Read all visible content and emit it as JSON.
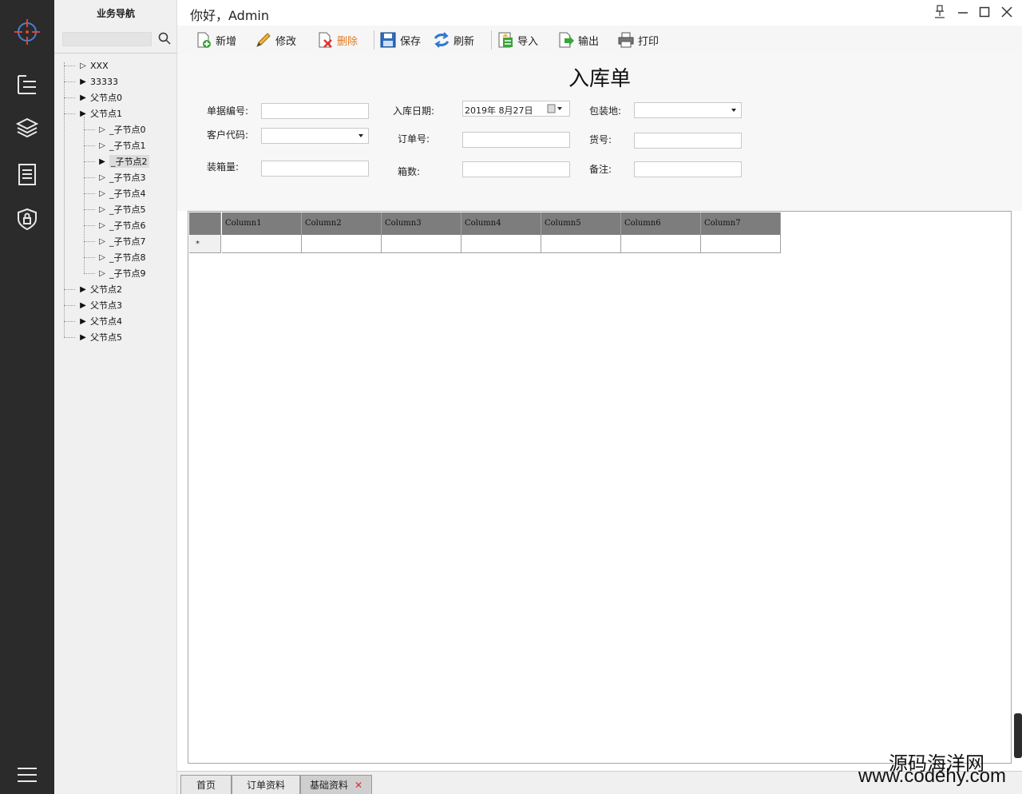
{
  "nav": {
    "title": "业务导航",
    "search_placeholder": "",
    "tree": [
      {
        "label": "XXX",
        "level": 0,
        "expander": "▷"
      },
      {
        "label": "33333",
        "level": 0,
        "expander": "▶"
      },
      {
        "label": "父节点0",
        "level": 0,
        "expander": "▶"
      },
      {
        "label": "父节点1",
        "level": 0,
        "expander": "▶"
      },
      {
        "label": "_子节点0",
        "level": 1,
        "expander": "▷"
      },
      {
        "label": "_子节点1",
        "level": 1,
        "expander": "▷"
      },
      {
        "label": "_子节点2",
        "level": 1,
        "expander": "▶",
        "selected": true
      },
      {
        "label": "_子节点3",
        "level": 1,
        "expander": "▷"
      },
      {
        "label": "_子节点4",
        "level": 1,
        "expander": "▷"
      },
      {
        "label": "_子节点5",
        "level": 1,
        "expander": "▷"
      },
      {
        "label": "_子节点6",
        "level": 1,
        "expander": "▷"
      },
      {
        "label": "_子节点7",
        "level": 1,
        "expander": "▷"
      },
      {
        "label": "_子节点8",
        "level": 1,
        "expander": "▷"
      },
      {
        "label": "_子节点9",
        "level": 1,
        "expander": "▷"
      },
      {
        "label": "父节点2",
        "level": 0,
        "expander": "▶"
      },
      {
        "label": "父节点3",
        "level": 0,
        "expander": "▶"
      },
      {
        "label": "父节点4",
        "level": 0,
        "expander": "▶"
      },
      {
        "label": "父节点5",
        "level": 0,
        "expander": "▶"
      }
    ]
  },
  "titlebar": {
    "greeting": "你好，Admin"
  },
  "toolbar": {
    "buttons": [
      {
        "label": "新增",
        "icon": "add-doc-icon"
      },
      {
        "label": "修改",
        "icon": "pencil-icon"
      },
      {
        "label": "删除",
        "icon": "delete-doc-icon",
        "color": "#e07a1f"
      },
      {
        "label": "保存",
        "icon": "floppy-icon"
      },
      {
        "label": "刷新",
        "icon": "refresh-icon"
      },
      {
        "label": "导入",
        "icon": "import-icon"
      },
      {
        "label": "输出",
        "icon": "export-icon"
      },
      {
        "label": "打印",
        "icon": "printer-icon"
      }
    ]
  },
  "form": {
    "title": "入库单",
    "labels": {
      "doc_no": "单据编号:",
      "in_date": "入库日期:",
      "pack_place": "包装地:",
      "customer_code": "客户代码:",
      "order_no": "订单号:",
      "goods_no": "货号:",
      "box_qty": "装箱量:",
      "box_count": "箱数:",
      "remark": "备注:"
    },
    "values": {
      "doc_no": "",
      "in_date": "2019年  8月27日",
      "pack_place": "",
      "customer_code": "",
      "order_no": "",
      "goods_no": "",
      "box_qty": "",
      "box_count": "",
      "remark": ""
    }
  },
  "grid": {
    "columns": [
      "Column1",
      "Column2",
      "Column3",
      "Column4",
      "Column5",
      "Column6",
      "Column7"
    ],
    "new_row_marker": "*"
  },
  "tabs": [
    {
      "label": "首页",
      "active": false
    },
    {
      "label": "订单资料",
      "active": false
    },
    {
      "label": "基础资料",
      "active": true,
      "closable": true
    }
  ],
  "watermark": {
    "line1": "源码海洋网",
    "line2": "www.codehy.com"
  },
  "colors": {
    "rail": "#2b2b2b",
    "accent_red": "#d03030",
    "grid_header": "#7d7d7d",
    "delete_orange": "#e07a1f"
  }
}
